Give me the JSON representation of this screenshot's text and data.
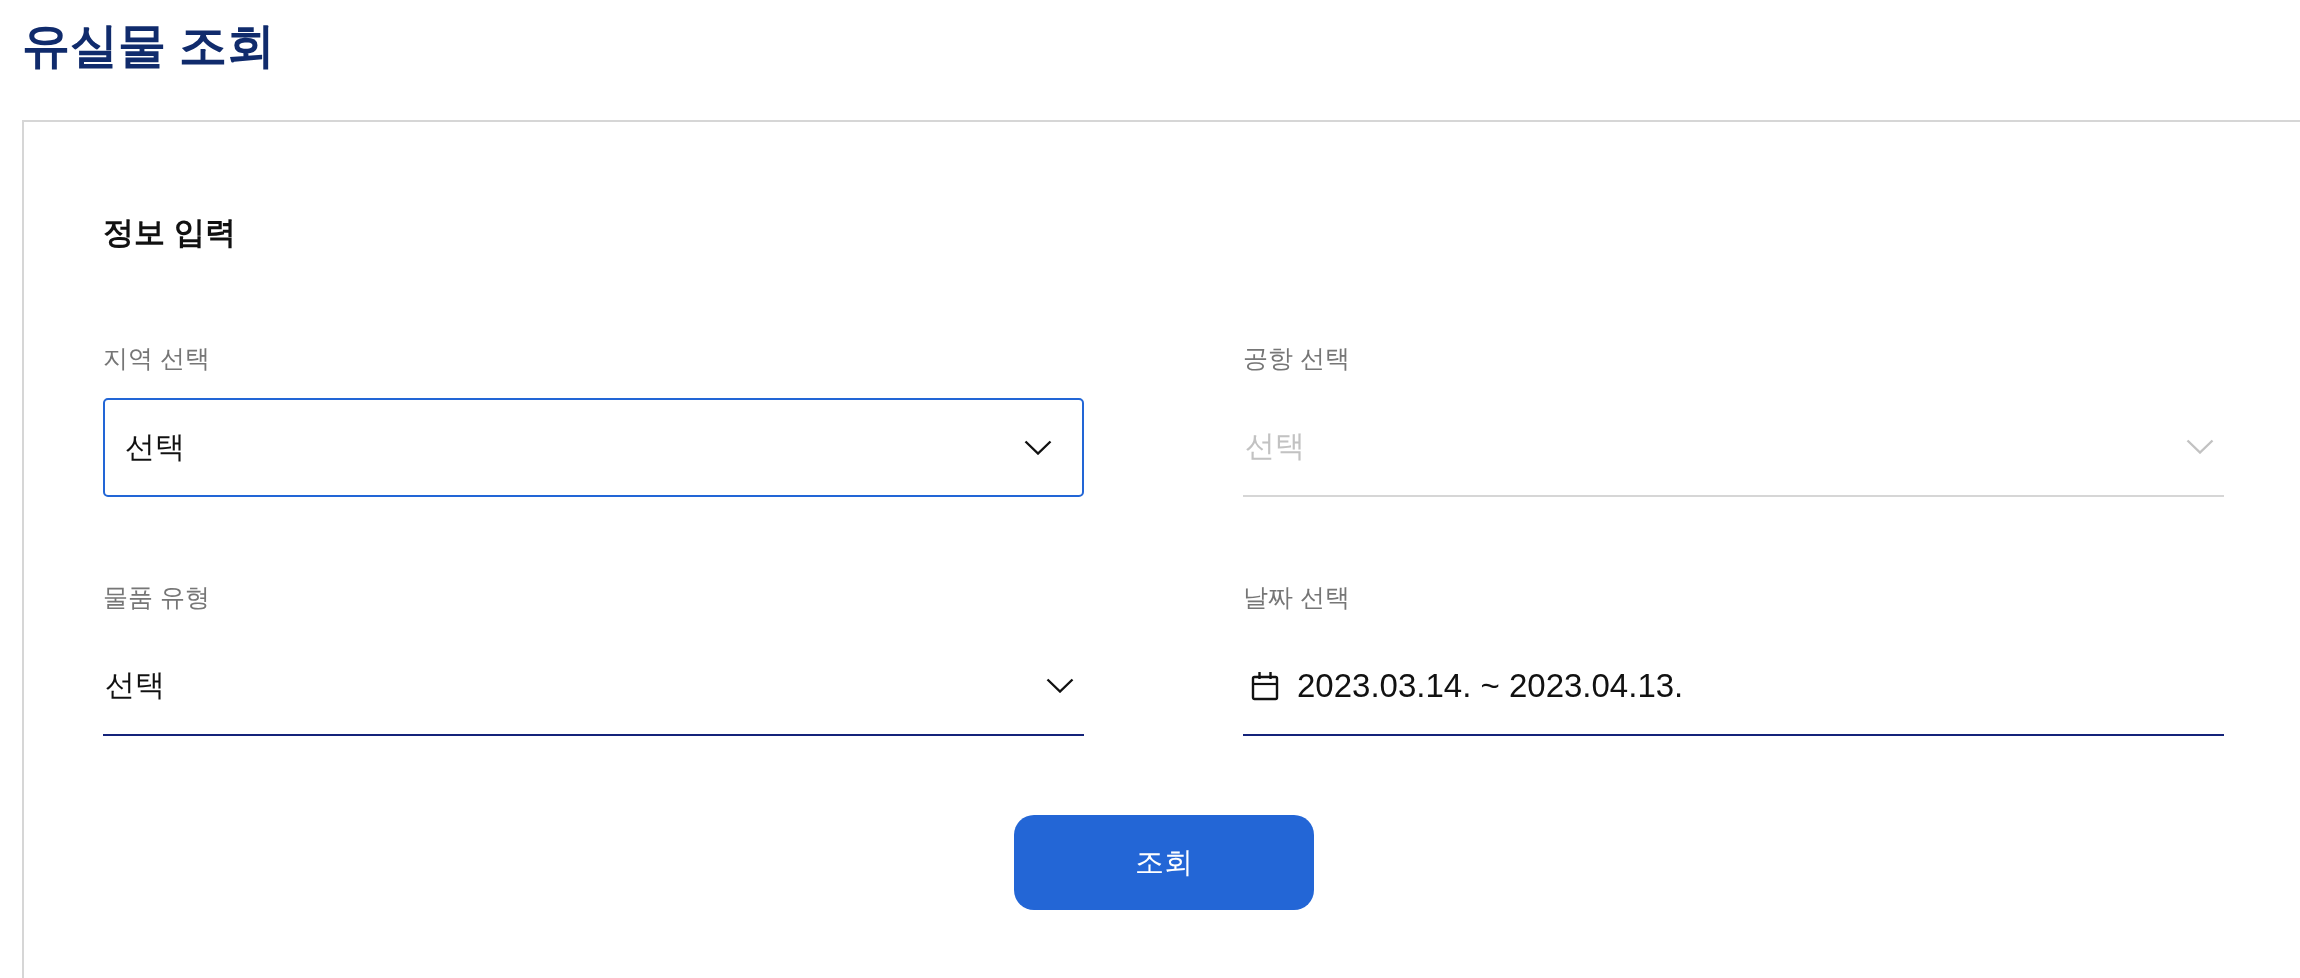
{
  "page": {
    "title": "유실물 조회"
  },
  "form": {
    "heading": "정보 입력",
    "fields": [
      {
        "kind": "select",
        "label": "지역 선택",
        "value": "선택",
        "focused": true,
        "disabled": false
      },
      {
        "kind": "select",
        "label": "공항 선택",
        "value": "선택",
        "focused": false,
        "disabled": true
      },
      {
        "kind": "select",
        "label": "물품 유형",
        "value": "선택",
        "focused": false,
        "disabled": false
      },
      {
        "kind": "date",
        "label": "날짜 선택",
        "value": "2023.03.14. ~ 2023.04.13.",
        "focused": false,
        "disabled": false
      }
    ],
    "submit_button": {
      "label": "조회"
    }
  }
}
